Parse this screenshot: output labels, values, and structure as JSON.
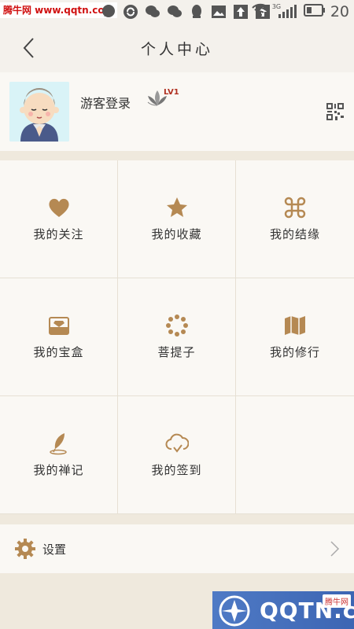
{
  "status": {
    "watermark_top": "腾牛网 www.qqtn.com",
    "signal_label": "3G",
    "time": "20"
  },
  "header": {
    "title": "个人中心"
  },
  "profile": {
    "username": "游客登录",
    "level": "LV1"
  },
  "grid": {
    "items": [
      {
        "label": "我的关注",
        "icon": "heart-icon"
      },
      {
        "label": "我的收藏",
        "icon": "star-icon"
      },
      {
        "label": "我的结缘",
        "icon": "command-icon"
      },
      {
        "label": "我的宝盒",
        "icon": "treasure-box-icon"
      },
      {
        "label": "菩提子",
        "icon": "prayer-beads-icon"
      },
      {
        "label": "我的修行",
        "icon": "map-icon"
      },
      {
        "label": "我的禅记",
        "icon": "quill-icon"
      },
      {
        "label": "我的签到",
        "icon": "cloud-check-icon"
      }
    ]
  },
  "settings": {
    "label": "设置"
  },
  "watermark_bottom": {
    "text": "QQTN.com",
    "tag": "腾牛网"
  },
  "colors": {
    "accent": "#b58953",
    "background": "#efe9dd"
  }
}
